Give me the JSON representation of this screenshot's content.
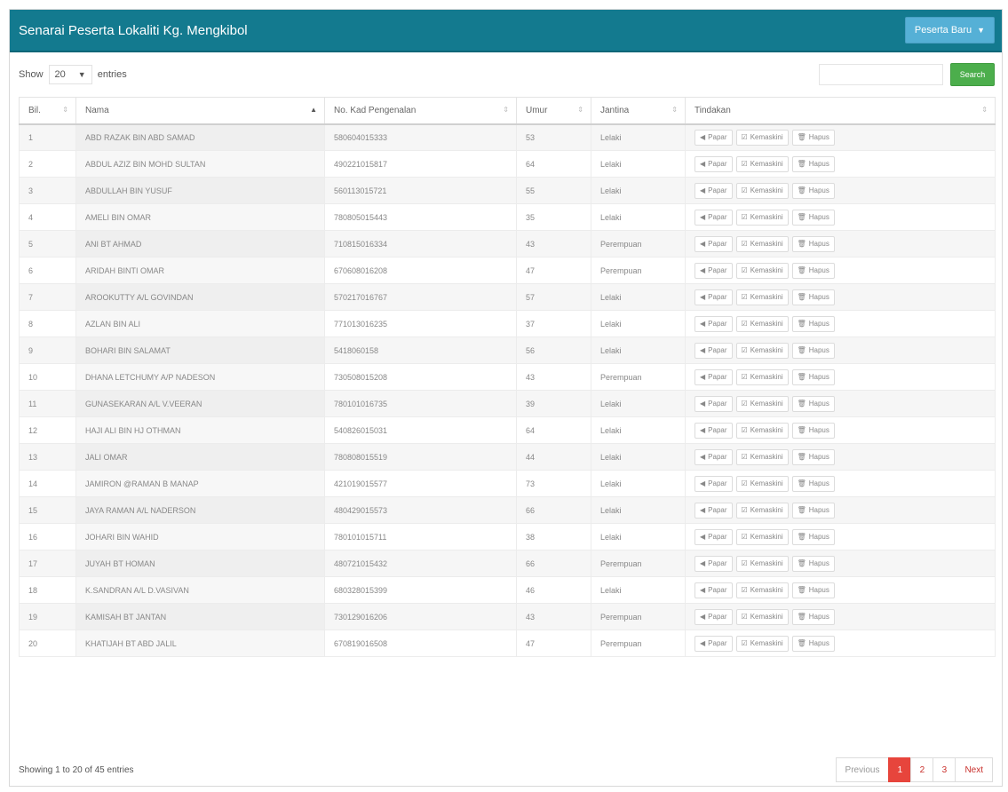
{
  "header": {
    "title": "Senarai Peserta Lokaliti Kg. Mengkibol",
    "peserta_button": "Peserta Baru"
  },
  "controls": {
    "show_label": "Show",
    "page_size": "20",
    "entries_label": "entries",
    "search_placeholder": "",
    "search_button": "Search"
  },
  "table": {
    "columns": [
      "Bil.",
      "Nama",
      "No. Kad Pengenalan",
      "Umur",
      "Jantina",
      "Tindakan"
    ],
    "actions": [
      "Papar",
      "Kemaskini",
      "Hapus"
    ],
    "rows": [
      {
        "bil": "1",
        "nama": "ABD RAZAK BIN ABD SAMAD",
        "ic": "580604015333",
        "umur": "53",
        "jantina": "Lelaki"
      },
      {
        "bil": "2",
        "nama": "ABDUL AZIZ BIN MOHD SULTAN",
        "ic": "490221015817",
        "umur": "64",
        "jantina": "Lelaki"
      },
      {
        "bil": "3",
        "nama": "ABDULLAH BIN YUSUF",
        "ic": "560113015721",
        "umur": "55",
        "jantina": "Lelaki"
      },
      {
        "bil": "4",
        "nama": "AMELI BIN OMAR",
        "ic": "780805015443",
        "umur": "35",
        "jantina": "Lelaki"
      },
      {
        "bil": "5",
        "nama": "ANI BT AHMAD",
        "ic": "710815016334",
        "umur": "43",
        "jantina": "Perempuan"
      },
      {
        "bil": "6",
        "nama": "ARIDAH BINTI OMAR",
        "ic": "670608016208",
        "umur": "47",
        "jantina": "Perempuan"
      },
      {
        "bil": "7",
        "nama": "AROOKUTTY A/L GOVINDAN",
        "ic": "570217016767",
        "umur": "57",
        "jantina": "Lelaki"
      },
      {
        "bil": "8",
        "nama": "AZLAN BIN ALI",
        "ic": "771013016235",
        "umur": "37",
        "jantina": "Lelaki"
      },
      {
        "bil": "9",
        "nama": "BOHARI BIN SALAMAT",
        "ic": "5418060158",
        "umur": "56",
        "jantina": "Lelaki"
      },
      {
        "bil": "10",
        "nama": "DHANA LETCHUMY A/P NADESON",
        "ic": "730508015208",
        "umur": "43",
        "jantina": "Perempuan"
      },
      {
        "bil": "11",
        "nama": "GUNASEKARAN A/L V.VEERAN",
        "ic": "780101016735",
        "umur": "39",
        "jantina": "Lelaki"
      },
      {
        "bil": "12",
        "nama": "HAJI ALI BIN HJ OTHMAN",
        "ic": "540826015031",
        "umur": "64",
        "jantina": "Lelaki"
      },
      {
        "bil": "13",
        "nama": "JALI OMAR",
        "ic": "780808015519",
        "umur": "44",
        "jantina": "Lelaki"
      },
      {
        "bil": "14",
        "nama": "JAMIRON @RAMAN B MANAP",
        "ic": "421019015577",
        "umur": "73",
        "jantina": "Lelaki"
      },
      {
        "bil": "15",
        "nama": "JAYA RAMAN A/L NADERSON",
        "ic": "480429015573",
        "umur": "66",
        "jantina": "Lelaki"
      },
      {
        "bil": "16",
        "nama": "JOHARI BIN WAHID",
        "ic": "780101015711",
        "umur": "38",
        "jantina": "Lelaki"
      },
      {
        "bil": "17",
        "nama": "JUYAH BT HOMAN",
        "ic": "480721015432",
        "umur": "66",
        "jantina": "Perempuan"
      },
      {
        "bil": "18",
        "nama": "K.SANDRAN A/L D.VASIVAN",
        "ic": "680328015399",
        "umur": "46",
        "jantina": "Lelaki"
      },
      {
        "bil": "19",
        "nama": "KAMISAH BT JANTAN",
        "ic": "730129016206",
        "umur": "43",
        "jantina": "Perempuan"
      },
      {
        "bil": "20",
        "nama": "KHATIJAH BT ABD JALIL",
        "ic": "670819016508",
        "umur": "47",
        "jantina": "Perempuan"
      }
    ]
  },
  "footer": {
    "info": "Showing 1 to 20 of 45 entries",
    "pager": [
      "Previous",
      "1",
      "2",
      "3",
      "Next"
    ]
  },
  "colors": {
    "header_bg": "#137a8f",
    "peserta_button": "#55b0d6",
    "search_button": "#4cae4c",
    "active_page": "#e7453c"
  },
  "icons": {
    "papar": "eye-icon",
    "kemaskini": "edit-icon",
    "hapus": "trash-icon",
    "peserta_caret": "caret-down-icon"
  }
}
